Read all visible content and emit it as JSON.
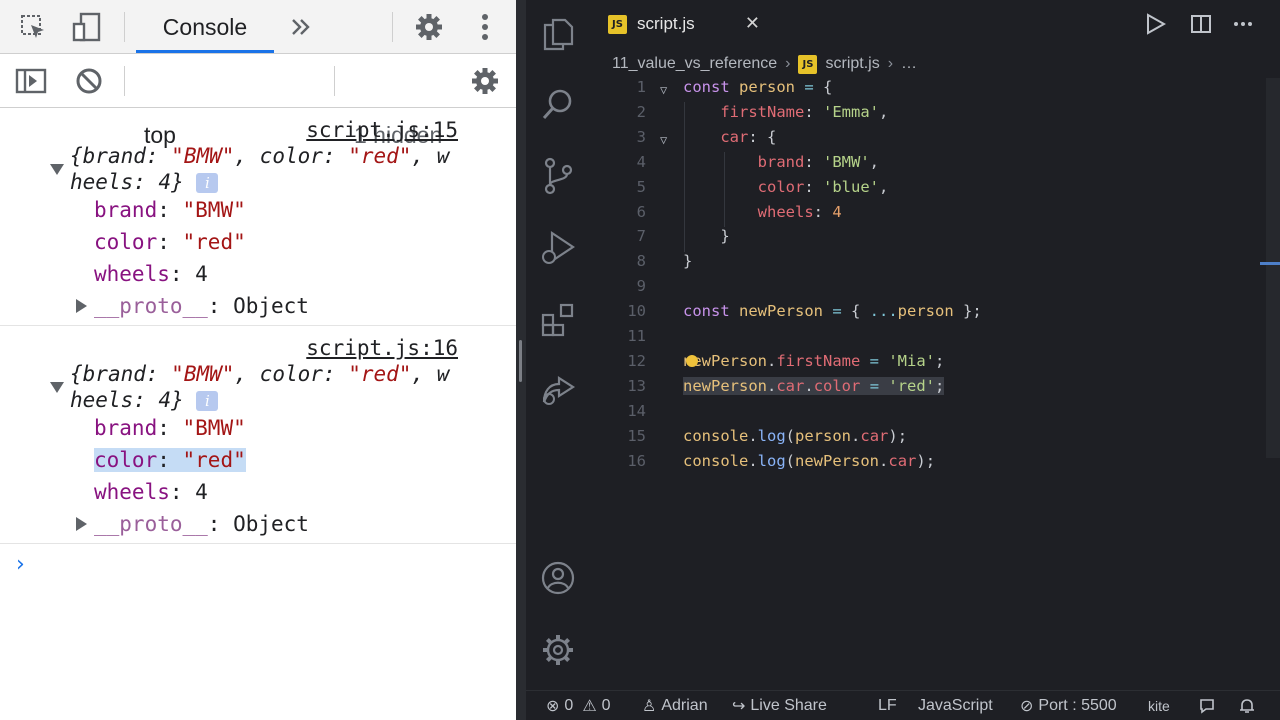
{
  "devtools": {
    "tab_label": "Console",
    "context": "top",
    "hidden_count": "1 hidden",
    "logs": [
      {
        "source": "script.js:15",
        "summary": [
          {
            "t": "{",
            "c": "k"
          },
          {
            "t": "brand: ",
            "c": "k"
          },
          {
            "t": "\"BMW\"",
            "c": "s"
          },
          {
            "t": ", color: ",
            "c": "k"
          },
          {
            "t": "\"red\"",
            "c": "s"
          },
          {
            "t": ", w",
            "c": "k"
          }
        ],
        "summary_line2": "heels: 4}",
        "props": [
          {
            "key": "brand",
            "value": "\"BMW\"",
            "kind": "s"
          },
          {
            "key": "color",
            "value": "\"red\"",
            "kind": "s"
          },
          {
            "key": "wheels",
            "value": "4",
            "kind": "n"
          }
        ],
        "proto": {
          "key": "__proto__",
          "value": "Object"
        }
      },
      {
        "source": "script.js:16",
        "summary": [
          {
            "t": "{",
            "c": "k"
          },
          {
            "t": "brand: ",
            "c": "k"
          },
          {
            "t": "\"BMW\"",
            "c": "s"
          },
          {
            "t": ", color: ",
            "c": "k"
          },
          {
            "t": "\"red\"",
            "c": "s"
          },
          {
            "t": ", w",
            "c": "k"
          }
        ],
        "summary_line2": "heels: 4}",
        "props": [
          {
            "key": "brand",
            "value": "\"BMW\"",
            "kind": "s"
          },
          {
            "key": "color",
            "value": "\"red\"",
            "kind": "s",
            "highlight": true
          },
          {
            "key": "wheels",
            "value": "4",
            "kind": "n"
          }
        ],
        "proto": {
          "key": "__proto__",
          "value": "Object"
        }
      }
    ],
    "info_badge": "i",
    "prompt": "›"
  },
  "vscode": {
    "tab": {
      "badge": "JS",
      "label": "script.js",
      "close": "✕"
    },
    "breadcrumb": {
      "folder": "11_value_vs_reference",
      "badge": "JS",
      "file": "script.js",
      "more": "…"
    },
    "line_numbers": [
      "1",
      "2",
      "3",
      "4",
      "5",
      "6",
      "7",
      "8",
      "9",
      "10",
      "11",
      "12",
      "13",
      "14",
      "15",
      "16"
    ],
    "code_lines": [
      [
        {
          "t": "const ",
          "c": "kw"
        },
        {
          "t": "person",
          "c": "var"
        },
        {
          "t": " = ",
          "c": "op"
        },
        {
          "t": "{",
          "c": "p"
        }
      ],
      [
        {
          "t": "    firstName",
          "c": "prp"
        },
        {
          "t": ": ",
          "c": "p"
        },
        {
          "t": "'Emma'",
          "c": "str"
        },
        {
          "t": ",",
          "c": "p"
        }
      ],
      [
        {
          "t": "    car",
          "c": "prp"
        },
        {
          "t": ": {",
          "c": "p"
        }
      ],
      [
        {
          "t": "        brand",
          "c": "prp"
        },
        {
          "t": ": ",
          "c": "p"
        },
        {
          "t": "'BMW'",
          "c": "str"
        },
        {
          "t": ",",
          "c": "p"
        }
      ],
      [
        {
          "t": "        color",
          "c": "prp"
        },
        {
          "t": ": ",
          "c": "p"
        },
        {
          "t": "'blue'",
          "c": "str"
        },
        {
          "t": ",",
          "c": "p"
        }
      ],
      [
        {
          "t": "        wheels",
          "c": "prp"
        },
        {
          "t": ": ",
          "c": "p"
        },
        {
          "t": "4",
          "c": "num"
        }
      ],
      [
        {
          "t": "    }",
          "c": "p"
        }
      ],
      [
        {
          "t": "}",
          "c": "p"
        }
      ],
      [],
      [
        {
          "t": "const ",
          "c": "kw"
        },
        {
          "t": "newPerson",
          "c": "var"
        },
        {
          "t": " = ",
          "c": "op"
        },
        {
          "t": "{ ",
          "c": "p"
        },
        {
          "t": "...",
          "c": "op"
        },
        {
          "t": "person",
          "c": "var"
        },
        {
          "t": " };",
          "c": "p"
        }
      ],
      [],
      [
        {
          "t": "newPerson",
          "c": "var"
        },
        {
          "t": ".",
          "c": "p"
        },
        {
          "t": "firstName",
          "c": "prp"
        },
        {
          "t": " = ",
          "c": "op"
        },
        {
          "t": "'Mia'",
          "c": "str"
        },
        {
          "t": ";",
          "c": "p"
        }
      ],
      [
        {
          "t": "newPerson",
          "c": "var"
        },
        {
          "t": ".",
          "c": "p"
        },
        {
          "t": "car",
          "c": "prp"
        },
        {
          "t": ".",
          "c": "p"
        },
        {
          "t": "color",
          "c": "prp"
        },
        {
          "t": " = ",
          "c": "op"
        },
        {
          "t": "'red'",
          "c": "str"
        },
        {
          "t": ";",
          "c": "p"
        }
      ],
      [],
      [
        {
          "t": "console",
          "c": "obj"
        },
        {
          "t": ".",
          "c": "p"
        },
        {
          "t": "log",
          "c": "fn"
        },
        {
          "t": "(",
          "c": "p"
        },
        {
          "t": "person",
          "c": "var"
        },
        {
          "t": ".",
          "c": "p"
        },
        {
          "t": "car",
          "c": "prp"
        },
        {
          "t": ");",
          "c": "p"
        }
      ],
      [
        {
          "t": "console",
          "c": "obj"
        },
        {
          "t": ".",
          "c": "p"
        },
        {
          "t": "log",
          "c": "fn"
        },
        {
          "t": "(",
          "c": "p"
        },
        {
          "t": "newPerson",
          "c": "var"
        },
        {
          "t": ".",
          "c": "p"
        },
        {
          "t": "car",
          "c": "prp"
        },
        {
          "t": ");",
          "c": "p"
        }
      ]
    ],
    "status": {
      "errors": "0",
      "warnings": "0",
      "user": "Adrian",
      "live_share": "Live Share",
      "eol": "LF",
      "language": "JavaScript",
      "port": "Port : 5500",
      "kite": "kite"
    }
  },
  "colors": {
    "accent": "#1a73e8",
    "editor_bg": "#1e1f24",
    "js_badge": "#e6c229",
    "cursor": "#f0c23b"
  }
}
